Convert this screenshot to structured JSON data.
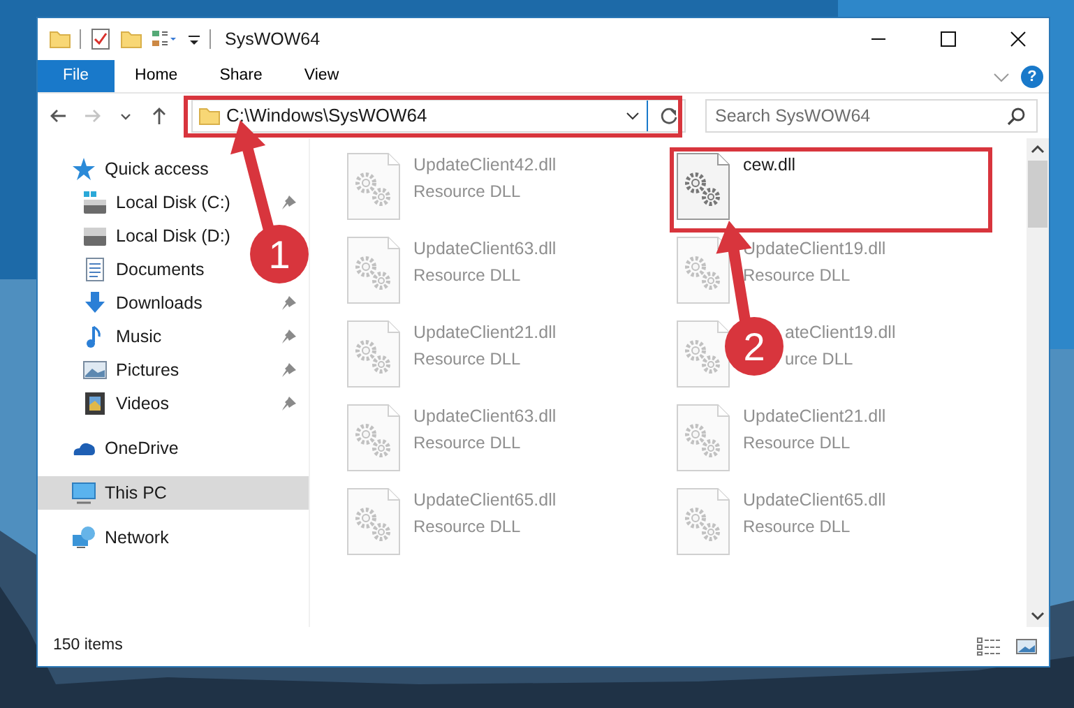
{
  "window": {
    "title": "SysWOW64"
  },
  "ribbon": {
    "tabs": [
      {
        "label": "File",
        "kind": "file"
      },
      {
        "label": "Home",
        "kind": "tab"
      },
      {
        "label": "Share",
        "kind": "tab"
      },
      {
        "label": "View",
        "kind": "tab"
      }
    ],
    "help": "?"
  },
  "nav_buttons": [
    {
      "kind": "back",
      "disabled": false
    },
    {
      "kind": "forward",
      "disabled": true
    },
    {
      "kind": "recent",
      "disabled": false
    },
    {
      "kind": "up",
      "disabled": false
    }
  ],
  "address": {
    "path": "C:\\Windows\\SysWOW64"
  },
  "search": {
    "placeholder": "Search SysWOW64"
  },
  "sidebar": {
    "items": [
      {
        "label": "Quick access",
        "kind": "star",
        "selected": false,
        "pinned": false,
        "children": [
          {
            "label": "Local Disk (C:)",
            "kind": "sysdrive",
            "selected": false,
            "pinned": true
          },
          {
            "label": "Local Disk (D:)",
            "kind": "drive",
            "selected": false,
            "pinned": false
          },
          {
            "label": "Documents",
            "kind": "documents",
            "selected": false,
            "pinned": false
          },
          {
            "label": "Downloads",
            "kind": "downloads",
            "selected": false,
            "pinned": true
          },
          {
            "label": "Music",
            "kind": "music",
            "selected": false,
            "pinned": true
          },
          {
            "label": "Pictures",
            "kind": "pictures",
            "selected": false,
            "pinned": true
          },
          {
            "label": "Videos",
            "kind": "videos",
            "selected": false,
            "pinned": true
          }
        ]
      },
      {
        "label": "OneDrive",
        "kind": "cloud",
        "selected": false,
        "pinned": false
      },
      {
        "label": "This PC",
        "kind": "pc",
        "selected": true,
        "pinned": false
      },
      {
        "label": "Network",
        "kind": "network",
        "selected": false,
        "pinned": false
      }
    ]
  },
  "files": [
    {
      "name": "UpdateClient42.dll",
      "type": "Resource DLL",
      "blurred": true
    },
    {
      "name": "cew.dll",
      "blurred": false
    },
    {
      "name": "UpdateClient63.dll",
      "type": "Resource DLL",
      "blurred": true
    },
    {
      "name": "UpdateClient19.dll",
      "type": "Resource DLL",
      "blurred": true
    },
    {
      "name": "UpdateClient21.dll",
      "type": "Resource DLL",
      "blurred": true
    },
    {
      "name": "ateClient19.dll",
      "type": "urce DLL",
      "blurred": true,
      "occluded": true
    },
    {
      "name": "UpdateClient63.dll",
      "type": "Resource DLL",
      "blurred": true
    },
    {
      "name": "UpdateClient21.dll",
      "type": "Resource DLL",
      "blurred": true
    },
    {
      "name": "UpdateClient65.dll",
      "type": "Resource DLL",
      "blurred": true
    },
    {
      "name": "UpdateClient65.dll",
      "type": "Resource DLL",
      "blurred": true
    }
  ],
  "status_bar": {
    "count": "150 items"
  },
  "annotations": [
    {
      "number": "1",
      "kind": "address"
    },
    {
      "number": "2",
      "kind": "file"
    }
  ]
}
